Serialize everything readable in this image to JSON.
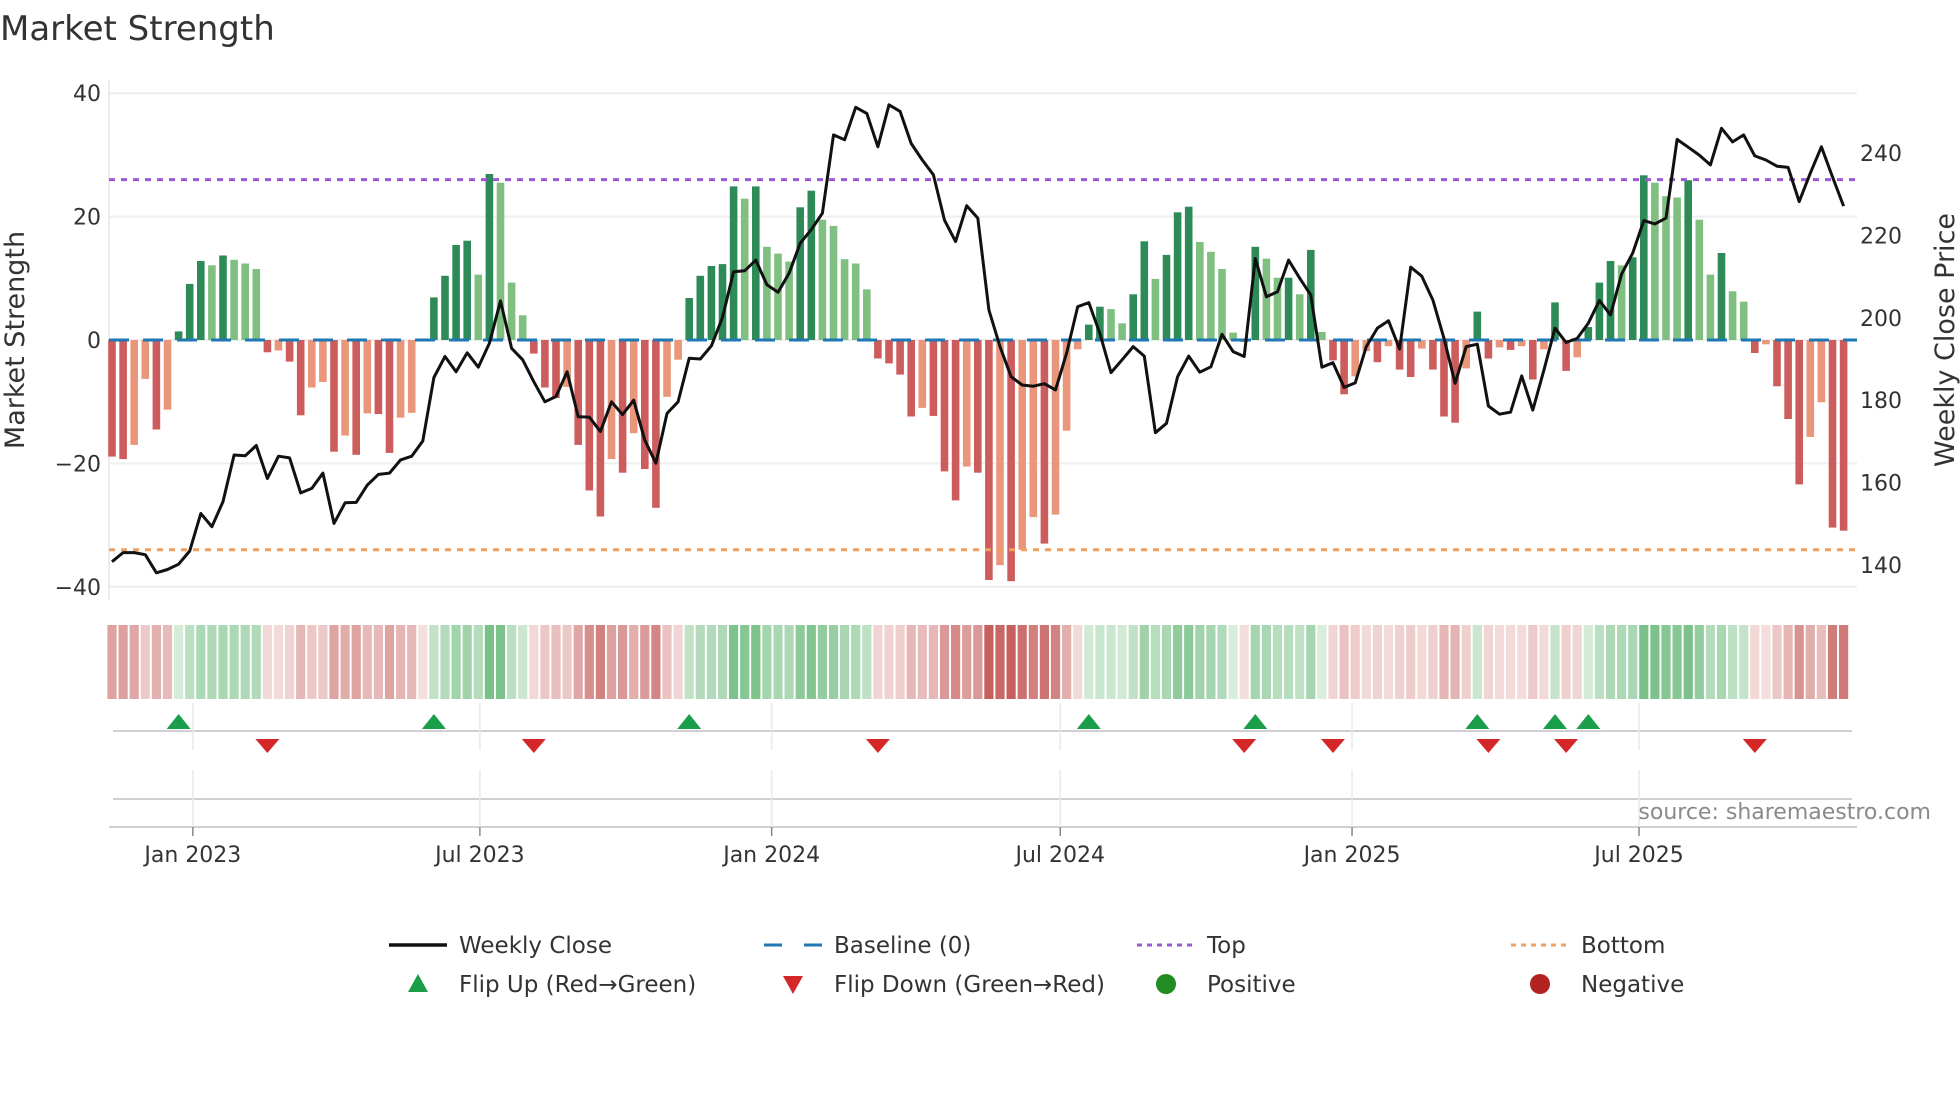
{
  "chart_data": {
    "type": "bar",
    "title": "Market Strength",
    "ylabel": "Market Strength",
    "y2label": "Weekly Close Price",
    "ylim": [
      -42,
      42
    ],
    "y2lim": [
      129,
      257
    ],
    "yticks": [
      40,
      20,
      0,
      -20,
      -40
    ],
    "ytick_labels": [
      "40",
      "20",
      "0",
      "−20",
      "−40"
    ],
    "y2ticks": [
      240,
      220,
      200,
      180,
      160,
      140
    ],
    "y2tick_labels": [
      "240",
      "220",
      "200",
      "180",
      "160",
      "140"
    ],
    "xticks": [
      {
        "date": "2023-01-01",
        "label": "Jan 2023"
      },
      {
        "date": "2023-07-01",
        "label": "Jul 2023"
      },
      {
        "date": "2024-01-01",
        "label": "Jan 2024"
      },
      {
        "date": "2024-07-01",
        "label": "Jul 2024"
      },
      {
        "date": "2025-01-01",
        "label": "Jan 2025"
      },
      {
        "date": "2025-07-01",
        "label": "Jul 2025"
      }
    ],
    "start_date": "2022-11-11",
    "interval_days": 7,
    "top_level": 26,
    "bottom_level": -34,
    "baseline": 0,
    "grid": true,
    "legend_position": "bottom-center",
    "strength": [
      -18.9,
      -19.3,
      -17,
      -6.3,
      -14.5,
      -11.3,
      1.4,
      9.1,
      12.8,
      12.1,
      13.7,
      13,
      12.4,
      11.5,
      -2,
      -1.7,
      -3.5,
      -12.2,
      -7.7,
      -6.8,
      -18.1,
      -15.5,
      -18.6,
      -11.9,
      -12,
      -18.3,
      -12.6,
      -11.8,
      -0.1,
      6.9,
      10.4,
      15.4,
      16.1,
      10.6,
      26.9,
      25.5,
      9.3,
      4,
      -2.2,
      -7.7,
      -9.4,
      -7.6,
      -17,
      -24.4,
      -28.6,
      -19.3,
      -21.5,
      -15.1,
      -20.9,
      -27.2,
      -9.2,
      -3.2,
      6.8,
      10.4,
      12,
      12.3,
      24.9,
      22.9,
      24.9,
      15.1,
      14,
      12.7,
      21.5,
      24.2,
      19.5,
      18.5,
      13.1,
      12.4,
      8.2,
      -3,
      -3.8,
      -5.6,
      -12.4,
      -11,
      -12.3,
      -21.3,
      -26,
      -20.5,
      -21.5,
      -38.9,
      -36.5,
      -39.1,
      -34,
      -28.7,
      -33,
      -28.3,
      -14.7,
      -1.5,
      2.5,
      5.4,
      5,
      2.7,
      7.4,
      16,
      9.9,
      13.8,
      20.7,
      21.6,
      15.9,
      14.3,
      11.5,
      1.2,
      -0.3,
      15.1,
      13.2,
      10.1,
      10.1,
      7.4,
      14.6,
      1.3,
      -3.3,
      -8.8,
      -5.9,
      -1.8,
      -3.6,
      -1,
      -4.8,
      -6,
      -1.4,
      -4.8,
      -12.4,
      -13.4,
      -4.6,
      4.6,
      -3,
      -1.2,
      -1.6,
      -1,
      -6.4,
      -1.5,
      6.1,
      -5,
      -2.8,
      2.1,
      9.3,
      12.8,
      12.1,
      13.4,
      26.7,
      25.5,
      23.3,
      23.1,
      25.9,
      19.5,
      10.6,
      14.1,
      7.9,
      6.2,
      -2.1,
      -0.7,
      -7.5,
      -12.8,
      -23.4,
      -15.7,
      -10.1,
      -30.4,
      -30.9
    ],
    "weekly_close": [
      140.8,
      143,
      143,
      142.5,
      138.1,
      138.9,
      140.2,
      143.4,
      152.5,
      149.3,
      155.4,
      166.7,
      166.5,
      169,
      161,
      166.4,
      166,
      157.5,
      158.6,
      162.3,
      150.1,
      155.1,
      155.2,
      159.4,
      162,
      162.3,
      165.5,
      166.4,
      170.1,
      185.5,
      190.6,
      186.9,
      191.5,
      188,
      193.8,
      204.1,
      192.6,
      189.8,
      184.5,
      179.6,
      180.9,
      186.9,
      176,
      175.9,
      172.4,
      179.6,
      176.5,
      180,
      170.3,
      164.7,
      176.8,
      179.6,
      190.2,
      190,
      193.2,
      200.1,
      211.2,
      211.4,
      214,
      208,
      206.2,
      210.8,
      218.1,
      221.4,
      225.4,
      244.4,
      243.2,
      251.1,
      249.6,
      241.5,
      251.7,
      250.1,
      242.3,
      238.3,
      234.7,
      223.7,
      218.5,
      227.2,
      224.2,
      201.9,
      193,
      185.7,
      183.7,
      183.4,
      184,
      182.5,
      191.4,
      202.7,
      203.7,
      196.2,
      186.7,
      189.8,
      193,
      190.7,
      172.1,
      174.4,
      185.7,
      190.7,
      186.8,
      188.1,
      196,
      191.8,
      190.6,
      214.4,
      205.1,
      206.3,
      214,
      209.6,
      205.5,
      188,
      189.1,
      183.1,
      184.2,
      193,
      197.5,
      199.3,
      192.4,
      212.3,
      210.1,
      204.3,
      195,
      184.1,
      193,
      193.6,
      178.6,
      176.6,
      177.1,
      185.9,
      177.6,
      187.3,
      197.5,
      194,
      195,
      198.7,
      204.2,
      200.7,
      210.6,
      215.7,
      223.6,
      222.8,
      224.2,
      243.3,
      241.4,
      239.5,
      237.1,
      246,
      242.7,
      244.4,
      239.3,
      238.3,
      236.8,
      236.5,
      228.2,
      235.1,
      241.5,
      234.2,
      227.1
    ],
    "flip_up_dates": [
      "2022-12-23",
      "2023-06-02",
      "2023-11-10",
      "2024-07-19",
      "2024-11-01",
      "2025-03-21",
      "2025-05-09",
      "2025-05-30"
    ],
    "flip_down_dates": [
      "2023-02-17",
      "2023-08-04",
      "2024-03-08",
      "2024-10-25",
      "2024-12-20",
      "2025-03-28",
      "2025-05-16",
      "2025-09-12"
    ],
    "legend": [
      {
        "label": "Weekly Close",
        "symbol": "line"
      },
      {
        "label": "Baseline (0)",
        "symbol": "dash"
      },
      {
        "label": "Top",
        "symbol": "dot"
      },
      {
        "label": "Bottom",
        "symbol": "dot"
      },
      {
        "label": "Flip Up (Red→Green)",
        "symbol": "triangle-up"
      },
      {
        "label": "Flip Down (Green→Red)",
        "symbol": "triangle-down"
      },
      {
        "label": "Positive",
        "symbol": "circle"
      },
      {
        "label": "Negative",
        "symbol": "circle"
      }
    ],
    "source": "source: sharemaestro.com"
  },
  "colors": {
    "pos_dark": "#2e8b57",
    "pos_light": "#7fbf7f",
    "neg_dark": "#cd5c5c",
    "neg_light": "#e9967a",
    "close": "#111111",
    "baseline": "#1f77b4",
    "top": "#9b59d6",
    "bottom": "#f0a060",
    "flip_up": "#1a9e4a",
    "flip_down": "#d62728",
    "positive": "#228b22",
    "negative": "#b22222",
    "strip_pos": "#3aa34f",
    "strip_neg": "#c0504d"
  }
}
